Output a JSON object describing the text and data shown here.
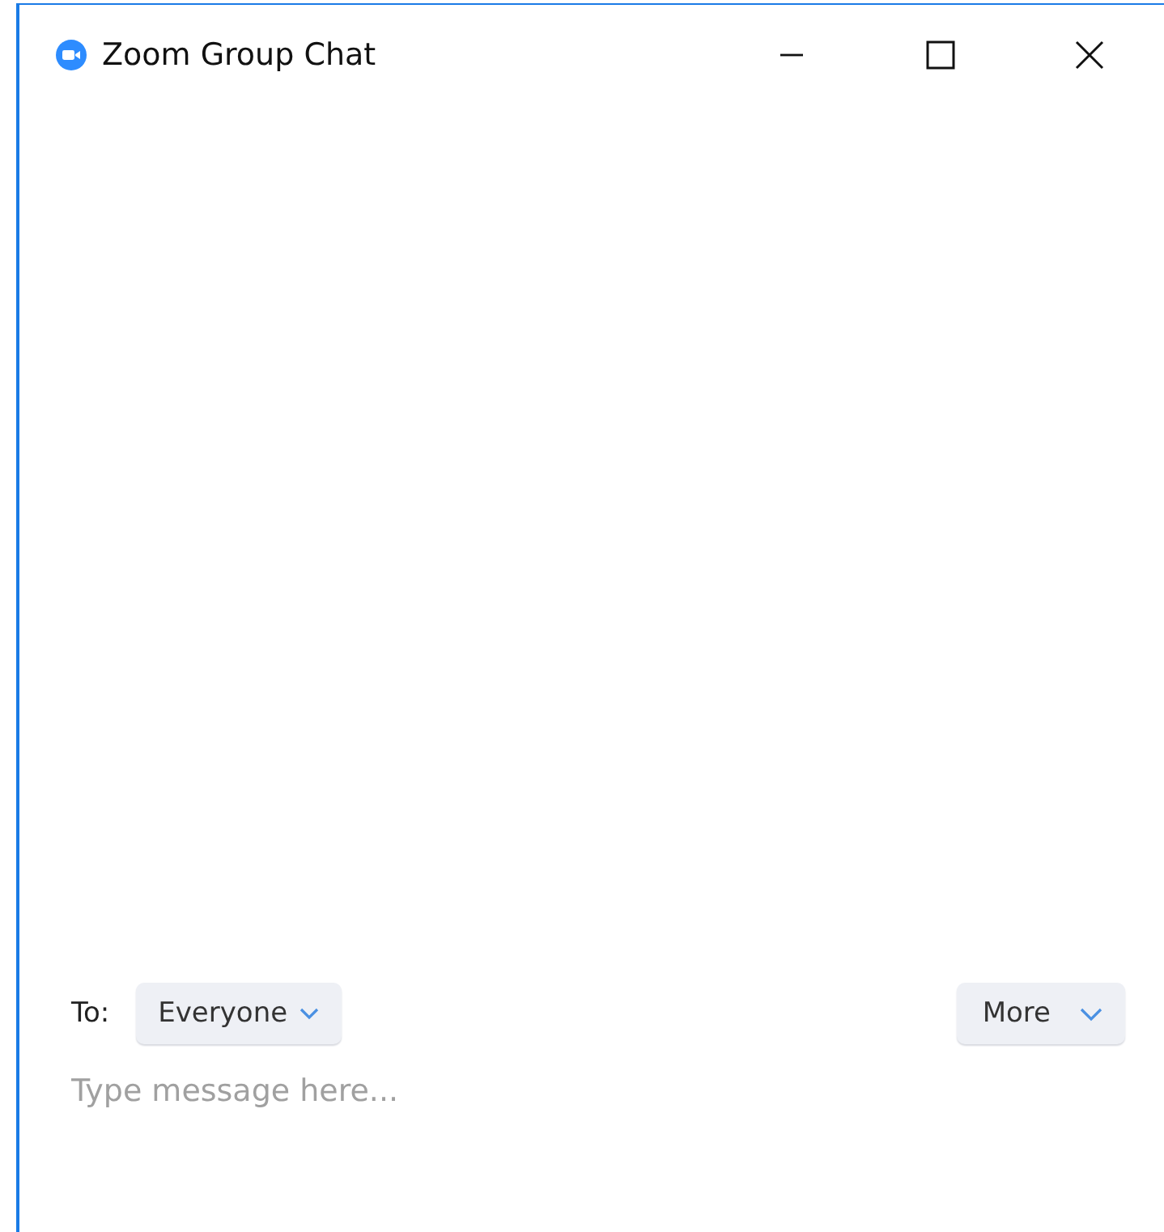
{
  "window": {
    "title": "Zoom Group Chat"
  },
  "recipient": {
    "label": "To:",
    "value": "Everyone"
  },
  "more_button": {
    "label": "More"
  },
  "message": {
    "placeholder": "Type message here..."
  }
}
